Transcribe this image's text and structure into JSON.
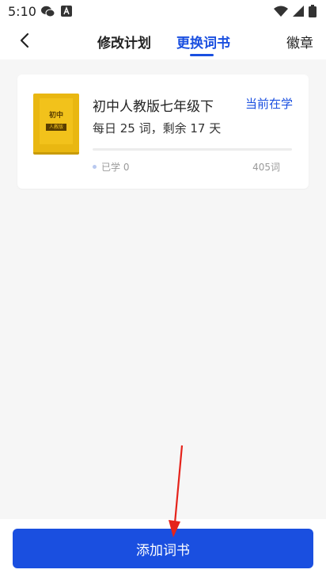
{
  "status": {
    "time": "5:10"
  },
  "header": {
    "tab_plan": "修改计划",
    "tab_book": "更换词书",
    "tab_badge": "徽章"
  },
  "book": {
    "cover_title": "初中",
    "cover_tag": "人教版",
    "title": "初中人教版七年级下",
    "current_label": "当前在学",
    "plan": "每日 25 词，剩余 17 天",
    "learned": "已学 0",
    "total": "405词",
    "progress": 0
  },
  "footer": {
    "add_button": "添加词书"
  },
  "colors": {
    "accent": "#1a4fe0",
    "arrow": "#e5231b",
    "book": "#e9b711"
  }
}
